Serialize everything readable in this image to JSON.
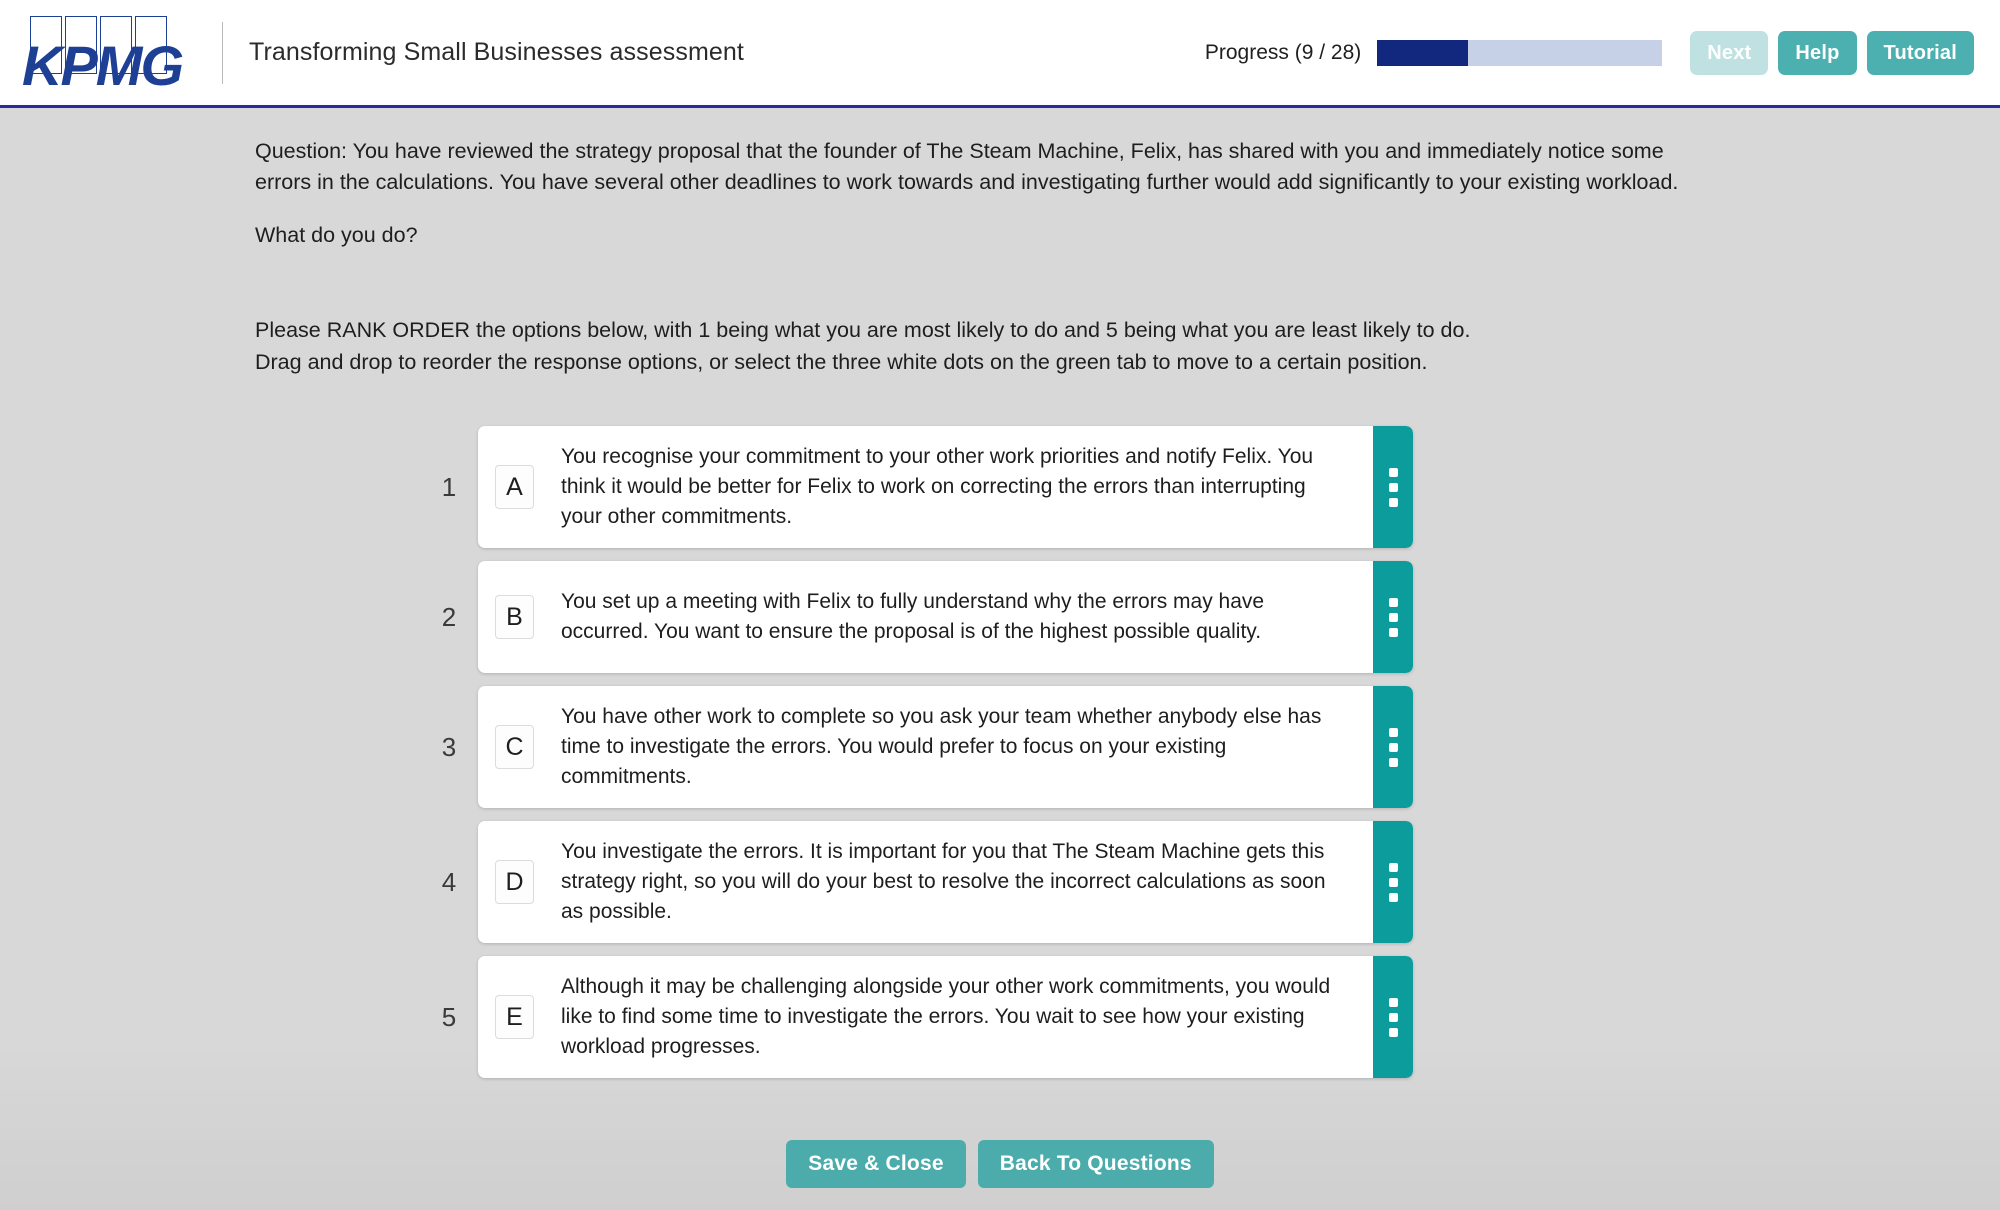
{
  "header": {
    "logo_text": "KPMG",
    "assessment_title": "Transforming Small Businesses assessment",
    "progress_label": "Progress (9 / 28)",
    "progress_current": 9,
    "progress_total": 28,
    "progress_percent": 32,
    "buttons": {
      "next": "Next",
      "help": "Help",
      "tutorial": "Tutorial"
    }
  },
  "question": {
    "prompt": "Question: You have reviewed the strategy proposal that the founder of The Steam Machine, Felix, has shared with you and immediately notice some errors in the calculations. You have several other deadlines to work towards and investigating further would add significantly to your existing workload.",
    "call_to_action": "What do you do?"
  },
  "instructions": {
    "line1": "Please RANK ORDER the options below, with 1 being what you are most likely to do and 5 being what you are least likely to do.",
    "line2": "Drag and drop to reorder the response options, or select the three white dots on the green tab to move to a certain position."
  },
  "options": [
    {
      "rank": "1",
      "letter": "A",
      "text": "You recognise your commitment to your other work priorities and notify Felix. You think it would be better for Felix to work on correcting the errors than interrupting your other commitments."
    },
    {
      "rank": "2",
      "letter": "B",
      "text": "You set up a meeting with Felix to fully understand why the errors may have occurred. You want to ensure the proposal is of the highest possible quality."
    },
    {
      "rank": "3",
      "letter": "C",
      "text": "You have other work to complete so you ask your team whether anybody else has time to investigate the errors. You would prefer to focus on your existing commitments."
    },
    {
      "rank": "4",
      "letter": "D",
      "text": "You investigate the errors. It is important for you that The Steam Machine gets this strategy right, so you will do your best to resolve the incorrect calculations as soon as possible."
    },
    {
      "rank": "5",
      "letter": "E",
      "text": "Although it may be challenging alongside your other work commitments, you would like to find some time to investigate the errors. You wait to see how your existing workload progresses."
    }
  ],
  "footer": {
    "save_close": "Save & Close",
    "back_to_questions": "Back To Questions"
  },
  "colors": {
    "brand_blue": "#1d3f94",
    "header_rule": "#2a2a9c",
    "progress_fill": "#12287e",
    "progress_track": "#c6d0e6",
    "tab_teal": "#0c9c9c",
    "button_teal": "#4cacac",
    "button_disabled": "#bfe1e1",
    "page_background": "#d8d8d8"
  }
}
